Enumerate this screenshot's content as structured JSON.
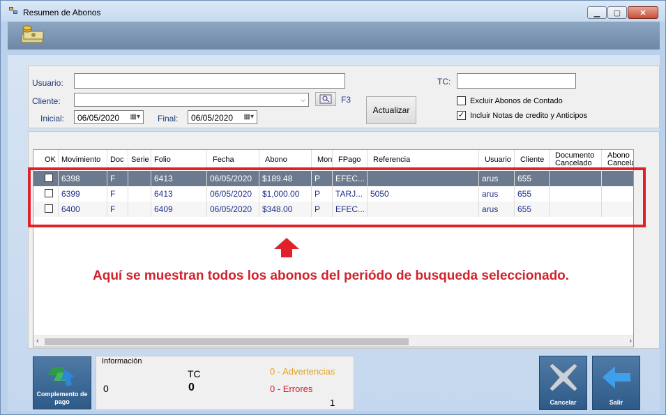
{
  "window": {
    "title": "Resumen de Abonos"
  },
  "filters": {
    "usuario_label": "Usuario:",
    "usuario_value": "",
    "cliente_label": "Cliente:",
    "cliente_value": "",
    "lookup_shortcut": "F3",
    "inicial_label": "Inicial:",
    "inicial_value": "06/05/2020",
    "final_label": "Final:",
    "final_value": "06/05/2020",
    "actualizar_label": "Actualizar",
    "tc_label": "TC:",
    "tc_value": "",
    "excluir_label": "Excluir Abonos de Contado",
    "excluir_checked": false,
    "incluir_label": "Incluir Notas de credito y Anticipos",
    "incluir_checked": true
  },
  "grid": {
    "columns": [
      "OK",
      "Movimiento",
      "Doc",
      "Serie",
      "Folio",
      "Fecha",
      "Abono",
      "Mon",
      "FPago",
      "Referencia",
      "Usuario",
      "Cliente",
      "Documento Cancelado",
      "Abono Cancela"
    ],
    "rows": [
      {
        "ok": false,
        "movimiento": "6398",
        "doc": "F",
        "serie": "",
        "folio": "6413",
        "fecha": "06/05/2020",
        "abono": "$189.48",
        "mon": "P",
        "fpago": "EFEC...",
        "referencia": "",
        "usuario": "arus",
        "cliente": "655",
        "doc_cancelado": "",
        "abono_cancela": ""
      },
      {
        "ok": false,
        "movimiento": "6399",
        "doc": "F",
        "serie": "",
        "folio": "6413",
        "fecha": "06/05/2020",
        "abono": "$1,000.00",
        "mon": "P",
        "fpago": "TARJ...",
        "referencia": "5050",
        "usuario": "arus",
        "cliente": "655",
        "doc_cancelado": "",
        "abono_cancela": ""
      },
      {
        "ok": false,
        "movimiento": "6400",
        "doc": "F",
        "serie": "",
        "folio": "6409",
        "fecha": "06/05/2020",
        "abono": "$348.00",
        "mon": "P",
        "fpago": "EFEC...",
        "referencia": "",
        "usuario": "arus",
        "cliente": "655",
        "doc_cancelado": "",
        "abono_cancela": ""
      }
    ]
  },
  "annotation": {
    "text": "Aquí se muestran todos los abonos del periódo de busqueda seleccionado.",
    "color": "#d0222d"
  },
  "footer": {
    "complemento_label": "Complemento de pago",
    "info_title": "Información",
    "info_count": "0",
    "tc_label": "TC",
    "tc_value": "0",
    "advertencias": "0 - Advertencias",
    "errores": "0 - Errores",
    "page": "1",
    "cancelar_label": "Cancelar",
    "salir_label": "Salir"
  },
  "colors": {
    "selected_row": "#6b7a8e",
    "grid_text": "#1f2f8a",
    "advertencias": "#e8a020",
    "errores": "#d0222d"
  }
}
